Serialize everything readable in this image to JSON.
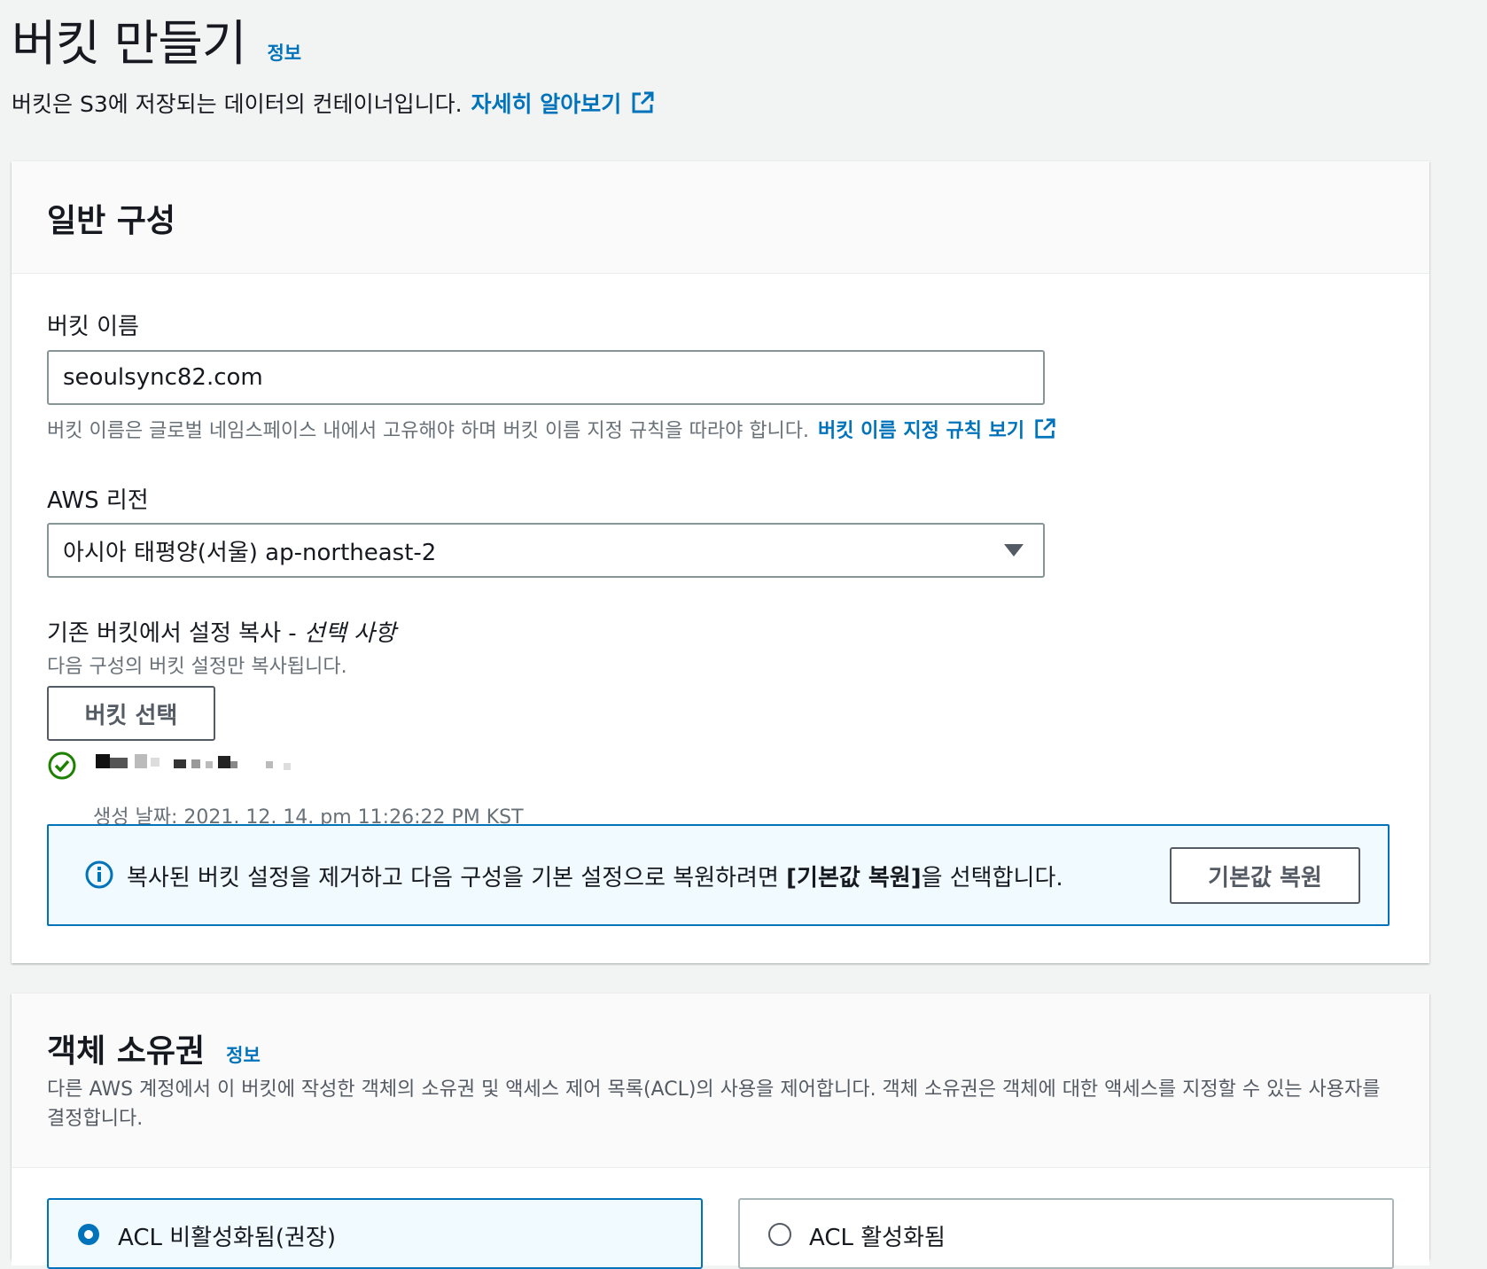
{
  "header": {
    "title": "버킷 만들기",
    "info": "정보",
    "description": "버킷은 S3에 저장되는 데이터의 컨테이너입니다.",
    "learn_more": "자세히 알아보기"
  },
  "general": {
    "title": "일반 구성",
    "bucket_name_label": "버킷 이름",
    "bucket_name_value": "seoulsync82.com",
    "bucket_name_hint": "버킷 이름은 글로벌 네임스페이스 내에서 고유해야 하며 버킷 이름 지정 규칙을 따라야 합니다.",
    "bucket_name_rules_link": "버킷 이름 지정 규칙 보기",
    "region_label": "AWS 리전",
    "region_value": "아시아 태평양(서울) ap-northeast-2",
    "copy_label": "기존 버킷에서 설정 복사 - ",
    "copy_optional": "선택 사항",
    "copy_hint": "다음 구성의 버킷 설정만 복사됩니다.",
    "choose_bucket_button": "버킷 선택",
    "created_date": "생성 날짜: 2021. 12. 14. pm 11:26:22 PM KST",
    "alert_text_pre": "복사된 버킷 설정을 제거하고 다음 구성을 기본 설정으로 복원하려면 ",
    "alert_text_bold": "[기본값 복원]",
    "alert_text_post": "을 선택합니다.",
    "restore_defaults_button": "기본값 복원"
  },
  "ownership": {
    "title": "객체 소유권",
    "info": "정보",
    "description": "다른 AWS 계정에서 이 버킷에 작성한 객체의 소유권 및 액세스 제어 목록(ACL)의 사용을 제어합니다. 객체 소유권은 객체에 대한 액세스를 지정할 수 있는 사용자를 결정합니다.",
    "option_disabled": "ACL 비활성화됨(권장)",
    "option_enabled": "ACL 활성화됨"
  },
  "colors": {
    "link": "#0073bb",
    "success": "#1d8102",
    "alert_bg": "#f1faff"
  }
}
